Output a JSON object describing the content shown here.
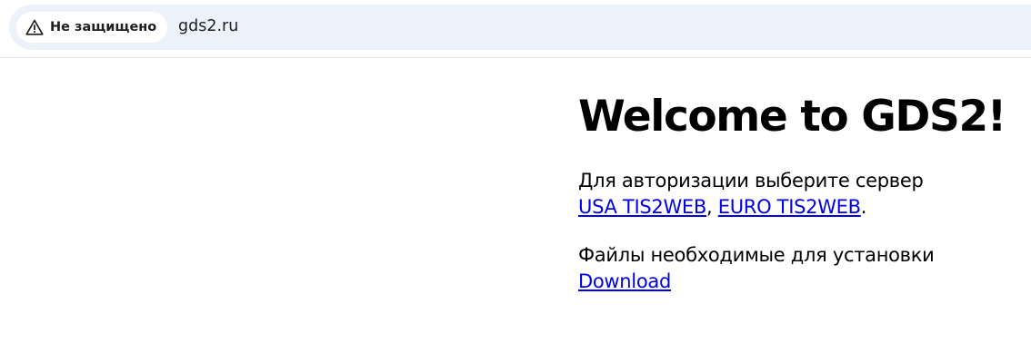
{
  "browser": {
    "security_label": "Не защищено",
    "security_icon": "warning-triangle-icon",
    "url": "gds2.ru"
  },
  "page": {
    "title": "Welcome to GDS2!",
    "auth_text": "Для авторизации выберите сервер",
    "usa_link": "USA TIS2WEB",
    "separator": ", ",
    "euro_link": "EURO TIS2WEB",
    "period": ".",
    "files_text": "Файлы необходимые для установки",
    "download_link": "Download"
  },
  "colors": {
    "link": "#0000ee",
    "address_bar_bg": "#edf2fa",
    "text": "#000000"
  }
}
